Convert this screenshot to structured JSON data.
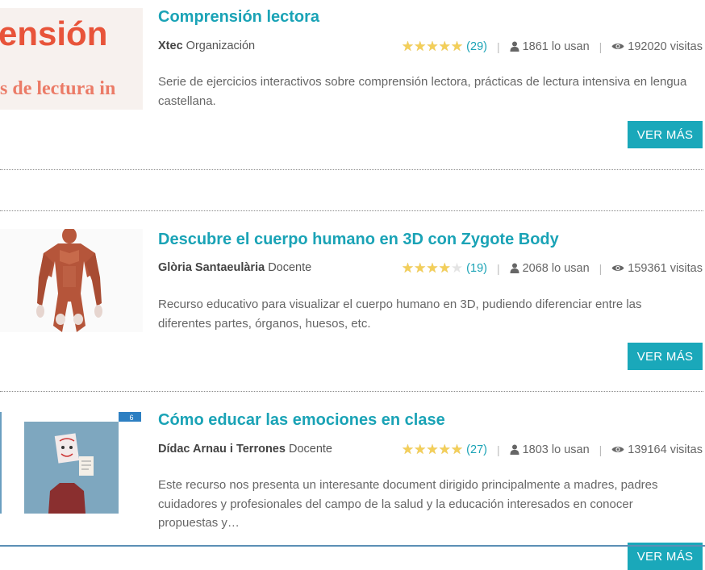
{
  "resources": [
    {
      "title": "Comprensión lectora",
      "author_name": "Xtec",
      "author_role": "Organización",
      "rating_stars": 5,
      "rating_count": "(29)",
      "users": "1861 lo usan",
      "views": "192020 visitas",
      "description": "Serie de ejercicios interactivos sobre comprensión lectora, prácticas de lectura intensiva en lengua castellana.",
      "button": "VER MÁS",
      "thumb_text_top": "ensión",
      "thumb_text_bottom": "s de lectura in"
    },
    {
      "title": "Descubre el cuerpo humano en 3D con Zygote Body",
      "author_name": "Glòria Santaeulària",
      "author_role": "Docente",
      "rating_stars": 4,
      "rating_count": "(19)",
      "users": "2068 lo usan",
      "views": "159361 visitas",
      "description": "Recurso educativo para visualizar el cuerpo humano en 3D, pudiendo diferenciar entre las diferentes partes, órganos, huesos, etc.",
      "button": "VER MÁS"
    },
    {
      "title": "Cómo educar las emociones en clase",
      "author_name": "Dídac Arnau i Terrones",
      "author_role": "Docente",
      "rating_stars": 5,
      "rating_count": "(27)",
      "users": "1803 lo usan",
      "views": "139164 visitas",
      "description": "Este recurso nos presenta un interesante document dirigido principalmente a madres, padres cuidadores y profesionales del campo de la salud y la educación interesados en conocer propuestas y…",
      "button": "VER MÁS",
      "thumb_badge": "6"
    }
  ],
  "colors": {
    "accent": "#1aa3b6",
    "button": "#1aa8ba",
    "star": "#f3cf5a",
    "thumb_red": "#e8543a"
  },
  "icons": {
    "rating": "star-icon",
    "users": "user-icon",
    "views": "eye-icon"
  }
}
